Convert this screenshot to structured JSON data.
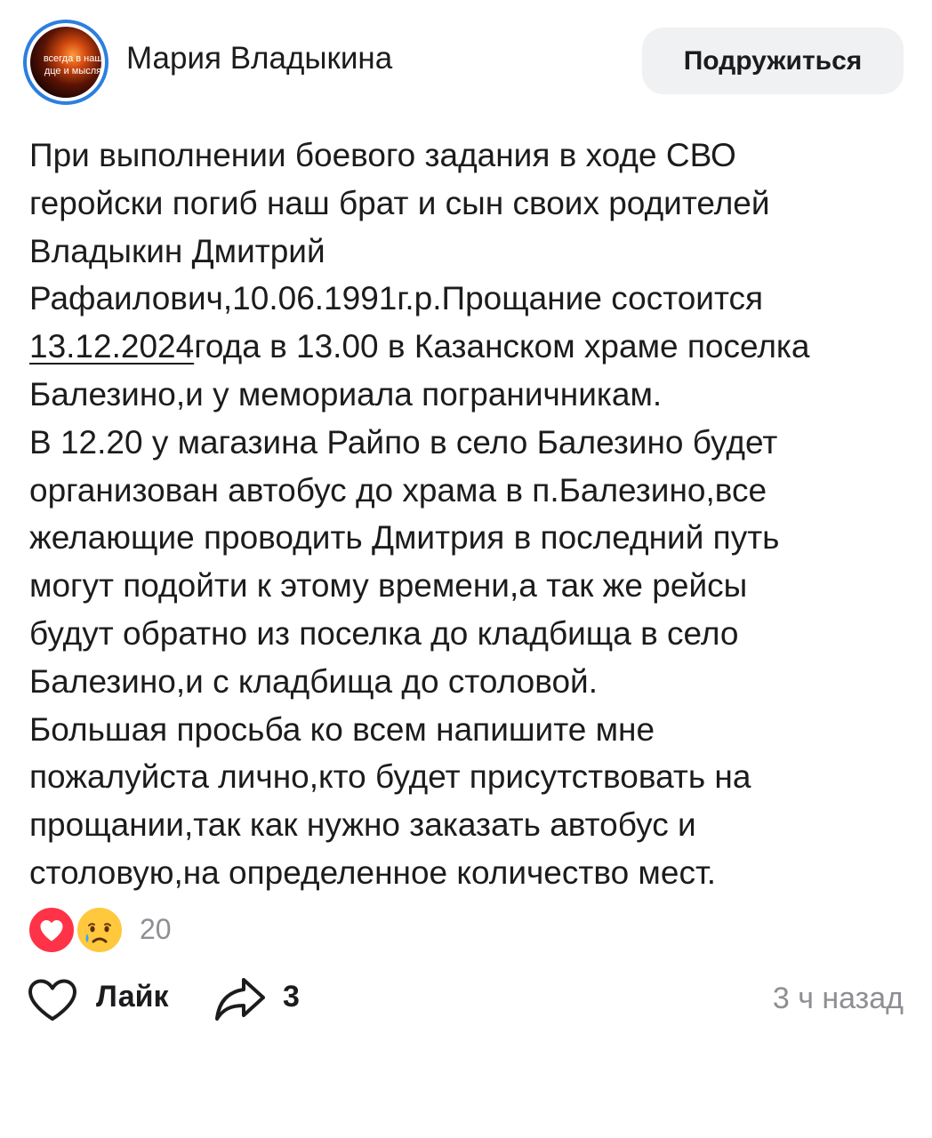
{
  "header": {
    "avatar_text": [
      "всегда в наш",
      "дце и мысля"
    ],
    "author_name": "Мария Владыкина",
    "friend_button": "Подружиться"
  },
  "post": {
    "lines": [
      "При выполнении боевого задания в ходе СВО",
      "геройски погиб наш брат и сын своих родителей",
      "Владыкин Дмитрий",
      "Рафаилович,10.06.1991г.р.Прощание состоится"
    ],
    "date_link": "13.12.2024",
    "date_line_rest": "года в 13.00 в Казанском храме поселка",
    "lines_after": [
      "Балезино,и у мемориала пограничникам.",
      "В 12.20 у магазина Райпо в село Балезино будет",
      "организован автобус до храма в п.Балезино,все",
      "желающие проводить Дмитрия в последний путь",
      "могут подойти к этому времени,а так же рейсы",
      "будут обратно из поселка до кладбища в село",
      "Балезино,и с кладбища до столовой.",
      "Большая просьба ко всем напишите мне",
      "пожалуйста лично,кто будет присутствовать на",
      "прощании,так как нужно заказать автобус и",
      "столовую,на определенное количество мест."
    ]
  },
  "reactions": {
    "icons": [
      "heart-icon",
      "crying-face-icon"
    ],
    "count": "20",
    "colors": {
      "heart": "#ff3347",
      "cry": "#ffc83d"
    }
  },
  "actions": {
    "like_label": "Лайк",
    "share_count": "3",
    "time_ago": "3 ч назад"
  },
  "colors": {
    "accent": "#2b7fe0",
    "text": "#1c1c1e",
    "muted": "#8e8e93",
    "button_bg": "#f0f1f3"
  }
}
